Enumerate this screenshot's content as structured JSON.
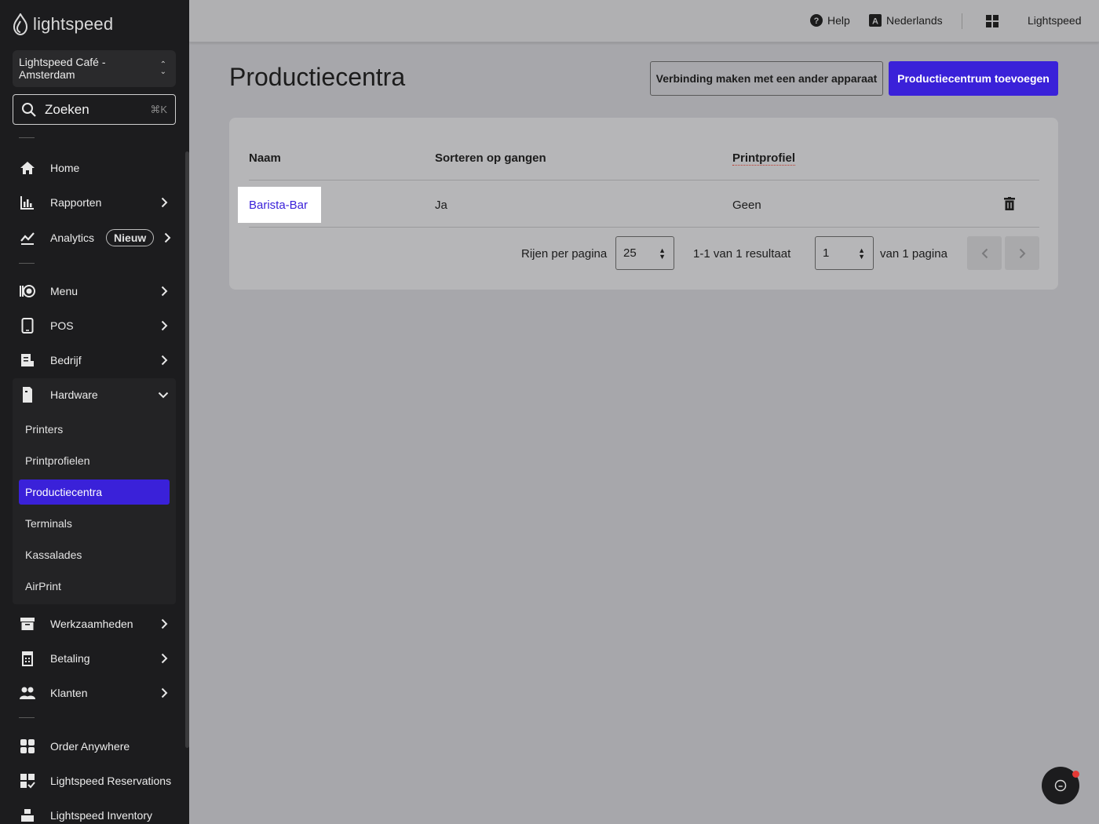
{
  "brand": {
    "logo_text": "lightspeed"
  },
  "sidebar": {
    "venue": "Lightspeed Café - Amsterdam",
    "search": {
      "placeholder": "Zoeken",
      "shortcut": "⌘K"
    },
    "items": [
      {
        "label": "Home",
        "icon": "home-icon"
      },
      {
        "label": "Rapporten",
        "icon": "bar-chart-icon"
      },
      {
        "label": "Analytics",
        "icon": "trend-icon",
        "badge": "Nieuw"
      },
      {
        "label": "Menu",
        "icon": "menu-plate-icon"
      },
      {
        "label": "POS",
        "icon": "tablet-icon"
      },
      {
        "label": "Bedrijf",
        "icon": "business-icon"
      },
      {
        "label": "Hardware",
        "icon": "hardware-icon"
      },
      {
        "label": "Werkzaamheden",
        "icon": "archive-icon"
      },
      {
        "label": "Betaling",
        "icon": "payment-icon"
      },
      {
        "label": "Klanten",
        "icon": "customers-icon"
      },
      {
        "label": "Order Anywhere",
        "icon": "order-anywhere-icon"
      },
      {
        "label": "Lightspeed Reservations",
        "icon": "reservations-icon"
      },
      {
        "label": "Lightspeed Inventory",
        "icon": "inventory-icon"
      }
    ],
    "hardware_sub": [
      "Printers",
      "Printprofielen",
      "Productiecentra",
      "Terminals",
      "Kassalades",
      "AirPrint"
    ],
    "active_sub": "Productiecentra"
  },
  "topbar": {
    "help": "Help",
    "language": "Nederlands",
    "account": "Lightspeed"
  },
  "page": {
    "title": "Productiecentra",
    "btn_connect": "Verbinding maken met een ander apparaat",
    "btn_add": "Productiecentrum toevoegen"
  },
  "table": {
    "headers": [
      "Naam",
      "Sorteren op gangen",
      "Printprofiel"
    ],
    "rows": [
      {
        "name": "Barista-Bar",
        "sort": "Ja",
        "profile": "Geen"
      }
    ]
  },
  "pagination": {
    "rows_label": "Rijen per pagina",
    "rows_value": "25",
    "result_text": "1-1 van 1 resultaat",
    "page_value": "1",
    "page_of": "van 1 pagina"
  },
  "colors": {
    "accent": "#3a21d9",
    "sidebar_bg": "#1c1c1e",
    "notification": "#e53935"
  }
}
